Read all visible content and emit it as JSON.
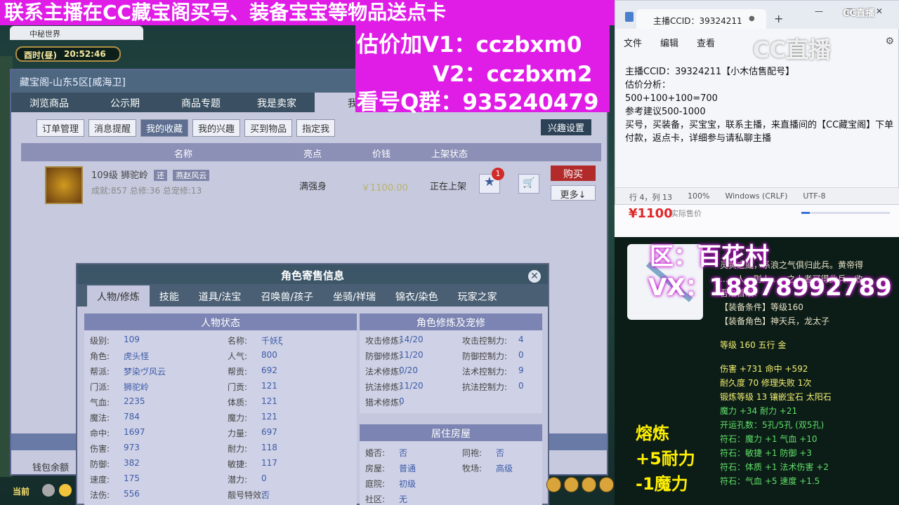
{
  "banner": {
    "main": "联系主播在CC藏宝阁买号、装备宝宝等物品送点卡",
    "price_v1": "估价加V1：cczbxm0",
    "price_v2": "V2：cczbxm2",
    "qq_group": "看号Q群：935240479"
  },
  "game": {
    "browser_tab": "中秘世界",
    "clock_period": "酉时(昼)",
    "clock_time": "20:52:46"
  },
  "cangbaoge": {
    "title": "藏宝阁-山东5区[威海卫]",
    "nav": [
      "浏览商品",
      "公示期",
      "商品专题",
      "我是卖家",
      "我"
    ],
    "subtabs": [
      "订单管理",
      "消息提醒",
      "我的收藏",
      "我的兴趣",
      "买到物品",
      "指定我"
    ],
    "interest_settings": "兴趣设置",
    "columns": [
      "名称",
      "亮点",
      "价钱",
      "上架状态"
    ],
    "item": {
      "name": "109级  狮驼岭",
      "tag1": "还",
      "tag2": "燕赵风云",
      "stats": "成就:857 总修:36 总宠修:13",
      "highlight": "满强身",
      "price": "￥1100.00",
      "status": "正在上架",
      "fav_count": "1",
      "buy": "购买",
      "more": "更多↓"
    },
    "wallet_label": "钱包余额"
  },
  "role_dialog": {
    "title": "角色寄售信息",
    "tabs": [
      "人物/修炼",
      "技能",
      "道具/法宝",
      "召唤兽/孩子",
      "坐骑/祥瑞",
      "锦衣/染色",
      "玩家之家"
    ],
    "status_title": "人物状态",
    "status_left": [
      {
        "k": "级别:",
        "v": "109"
      },
      {
        "k": "角色:",
        "v": "虎头怪"
      },
      {
        "k": "帮派:",
        "v": "梦染ヴ风云"
      },
      {
        "k": "门派:",
        "v": "狮驼岭"
      },
      {
        "k": "气血:",
        "v": "2235"
      },
      {
        "k": "魔法:",
        "v": "784"
      },
      {
        "k": "命中:",
        "v": "1697"
      },
      {
        "k": "伤害:",
        "v": "973"
      },
      {
        "k": "防御:",
        "v": "382"
      },
      {
        "k": "速度:",
        "v": "175"
      },
      {
        "k": "法伤:",
        "v": "556"
      }
    ],
    "status_right": [
      {
        "k": "名称:",
        "v": "千妖ξ"
      },
      {
        "k": "人气:",
        "v": "800"
      },
      {
        "k": "帮贡:",
        "v": "692"
      },
      {
        "k": "门贡:",
        "v": "121"
      },
      {
        "k": "体质:",
        "v": "121"
      },
      {
        "k": "魔力:",
        "v": "121"
      },
      {
        "k": "力量:",
        "v": "697"
      },
      {
        "k": "耐力:",
        "v": "118"
      },
      {
        "k": "敏捷:",
        "v": "117"
      },
      {
        "k": "潜力:",
        "v": "0"
      },
      {
        "k": "靓号特效:",
        "v": "否"
      }
    ],
    "cultivation_title": "角色修炼及宠修",
    "cultivation_left": [
      {
        "k": "攻击修炼:",
        "v": "14/20"
      },
      {
        "k": "防御修炼:",
        "v": "11/20"
      },
      {
        "k": "法术修炼:",
        "v": "0/20"
      },
      {
        "k": "抗法修炼:",
        "v": "11/20"
      },
      {
        "k": "猎术修炼:",
        "v": "0"
      }
    ],
    "cultivation_right": [
      {
        "k": "攻击控制力:",
        "v": "4"
      },
      {
        "k": "防御控制力:",
        "v": "0"
      },
      {
        "k": "法术控制力:",
        "v": "9"
      },
      {
        "k": "抗法控制力:",
        "v": "0"
      }
    ],
    "house_title": "居住房屋",
    "house_left": [
      {
        "k": "婚否:",
        "v": "否"
      },
      {
        "k": "房屋:",
        "v": "普通"
      },
      {
        "k": "庭院:",
        "v": "初级"
      },
      {
        "k": "社区:",
        "v": "无"
      }
    ],
    "house_right": [
      {
        "k": "同袍:",
        "v": "否"
      },
      {
        "k": "牧场:",
        "v": "高级"
      }
    ]
  },
  "bottom_bar": {
    "current": "当前"
  },
  "notepad": {
    "tab_title": "主播CCID：39324211",
    "menu": [
      "文件",
      "编辑",
      "查看"
    ],
    "lines": [
      "主播CCID：39324211【小木估售配号】",
      "估价分析：",
      "500+100+100=700",
      "参考建议500-1000",
      "买号，买装备，买宝宝，联系主播，来直播间的【CC藏宝阁】下单付款，返点卡，详细参与请私聊主播"
    ],
    "status": [
      "行 4，列 13",
      "100%",
      "Windows (CRLF)",
      "UTF-8"
    ]
  },
  "cc_logo": "CC直播",
  "mid": {
    "price": "¥1100",
    "sub": "实际售价"
  },
  "equipment": {
    "overlay_region": "区：百花村",
    "overlay_vx": "VX：18878992789",
    "lines": [
      {
        "t": "灵黄之威，系浪之气俱归此兵。黄帝得",
        "c": ""
      },
      {
        "t": "...，人，则人……之人者可得此兵…收",
        "c": ""
      },
      {
        "t": "吾之首级！",
        "c": ""
      },
      {
        "t": "【装备条件】等级160",
        "c": ""
      },
      {
        "t": "【装备角色】神天兵，龙太子",
        "c": ""
      },
      {
        "t": "",
        "c": "gap"
      },
      {
        "t": "等级 160 五行 金",
        "c": "y"
      },
      {
        "t": "",
        "c": "gap"
      },
      {
        "t": "伤害 +731 命中 +592",
        "c": "y"
      },
      {
        "t": "耐久度 70 修理失败 1次",
        "c": "y"
      },
      {
        "t": "锻炼等级 13 镶嵌宝石 太阳石",
        "c": "y"
      },
      {
        "t": "魔力 +34 耐力 +21",
        "c": "g"
      },
      {
        "t": "开运孔数：5孔/5孔 (双5孔)",
        "c": "g"
      },
      {
        "t": "符石：魔力 +1 气血 +10",
        "c": "g"
      },
      {
        "t": "符石：敏捷 +1 防御 +3",
        "c": "g"
      },
      {
        "t": "符石：体质 +1 法术伤害 +2",
        "c": "g"
      },
      {
        "t": "符石：气血 +5 速度 +1.5",
        "c": "g"
      }
    ],
    "forge_lines": [
      "熔炼",
      "+5耐力",
      "-1魔力"
    ]
  }
}
